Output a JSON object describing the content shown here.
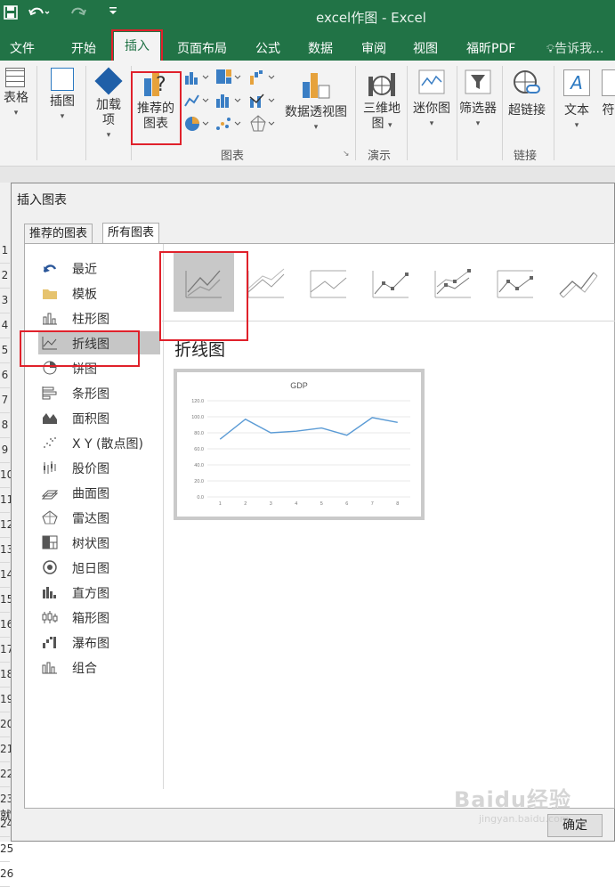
{
  "window": {
    "title": "excel作图 - Excel"
  },
  "tabs": [
    {
      "label": "文件"
    },
    {
      "label": "开始"
    },
    {
      "label": "插入"
    },
    {
      "label": "页面布局"
    },
    {
      "label": "公式"
    },
    {
      "label": "数据"
    },
    {
      "label": "审阅"
    },
    {
      "label": "视图"
    },
    {
      "label": "福昕PDF"
    },
    {
      "label": "告诉我..."
    }
  ],
  "ribbon": {
    "table": "表格",
    "illustrations": "插图",
    "addins_line1": "加载",
    "addins_line2": "项",
    "recommended_line1": "推荐的",
    "recommended_line2": "图表",
    "pivotchart": "数据透视图",
    "map3d_line1": "三维地",
    "map3d_line2": "图",
    "sparklines": "迷你图",
    "filters": "筛选器",
    "hyperlink": "超链接",
    "text": "文本",
    "symbols_partial": "符",
    "group_charts": "图表",
    "group_tours": "演示",
    "group_links": "链接"
  },
  "sheet": {
    "rows": [
      "1",
      "2",
      "3",
      "4",
      "5",
      "6",
      "7",
      "8",
      "9",
      "10",
      "11",
      "12",
      "13",
      "14",
      "15",
      "16",
      "17",
      "18",
      "19",
      "20",
      "21",
      "22",
      "23",
      "24",
      "25",
      "26"
    ],
    "bottom_label": "就"
  },
  "dialog": {
    "title": "插入图表",
    "tabs": [
      "推荐的图表",
      "所有图表"
    ],
    "selected_tab": "所有图表",
    "chart_types": [
      {
        "label": "最近",
        "icon": "recent-icon"
      },
      {
        "label": "模板",
        "icon": "folder-icon"
      },
      {
        "label": "柱形图",
        "icon": "column-chart-icon"
      },
      {
        "label": "折线图",
        "icon": "line-chart-icon"
      },
      {
        "label": "饼图",
        "icon": "pie-chart-icon"
      },
      {
        "label": "条形图",
        "icon": "bar-chart-icon"
      },
      {
        "label": "面积图",
        "icon": "area-chart-icon"
      },
      {
        "label": "X Y (散点图)",
        "icon": "scatter-chart-icon"
      },
      {
        "label": "股价图",
        "icon": "stock-chart-icon"
      },
      {
        "label": "曲面图",
        "icon": "surface-chart-icon"
      },
      {
        "label": "雷达图",
        "icon": "radar-chart-icon"
      },
      {
        "label": "树状图",
        "icon": "treemap-chart-icon"
      },
      {
        "label": "旭日图",
        "icon": "sunburst-chart-icon"
      },
      {
        "label": "直方图",
        "icon": "histogram-chart-icon"
      },
      {
        "label": "箱形图",
        "icon": "boxwhisker-chart-icon"
      },
      {
        "label": "瀑布图",
        "icon": "waterfall-chart-icon"
      },
      {
        "label": "组合",
        "icon": "combo-chart-icon"
      }
    ],
    "selected_type": "折线图",
    "chart_name": "折线图",
    "ok_label": "确定"
  },
  "chart_data": {
    "type": "line",
    "title": "GDP",
    "x": [
      1,
      2,
      3,
      4,
      5,
      6,
      7,
      8
    ],
    "categories": [
      "1",
      "2",
      "3",
      "4",
      "5",
      "6",
      "7",
      "8"
    ],
    "values": [
      72,
      97,
      80,
      82,
      86,
      77,
      99,
      93
    ],
    "ylim": [
      0,
      120
    ],
    "yticks": [
      "0.0",
      "20.0",
      "40.0",
      "60.0",
      "80.0",
      "100.0",
      "120.0"
    ],
    "xlabel": "",
    "ylabel": "",
    "color": "#5b9bd5",
    "grid": true
  },
  "colors": {
    "excel_green": "#217346",
    "highlight_red": "#e0212b"
  },
  "watermark": {
    "line1": "Baidu经验",
    "line2": "jingyan.baidu.com"
  }
}
